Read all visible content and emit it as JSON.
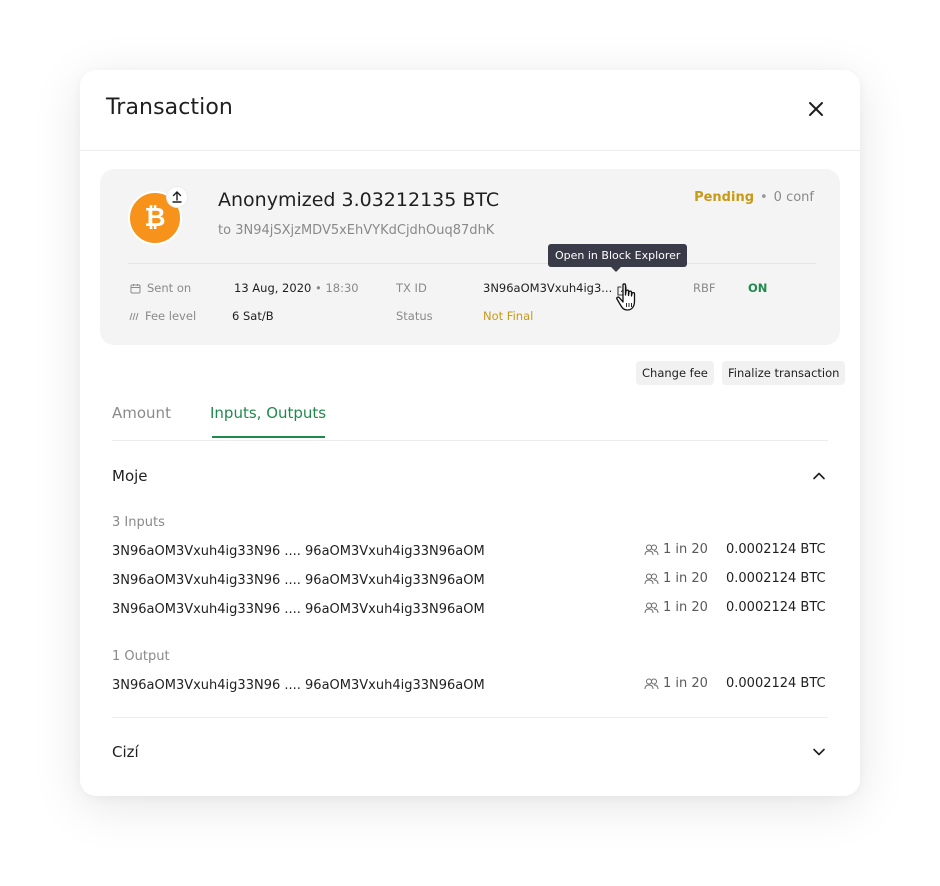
{
  "modal": {
    "title": "Transaction"
  },
  "transaction": {
    "title": "Anonymized 3.03212135 BTC",
    "to_prefix": "to",
    "to_address": "3N94jSXjzMDV5xEhVYKdCjdhOuq87dhK",
    "status": "Pending",
    "separator": "•",
    "confirmations": "0 conf",
    "coin_glyph": "₿",
    "coin_color": "#f7931a"
  },
  "details": {
    "sent_on_label": "Sent on",
    "sent_on_date": "13 Aug, 2020",
    "sent_on_sep": "•",
    "sent_on_time": "18:30",
    "fee_level_label": "Fee level",
    "fee_level_value": "6 Sat/B",
    "txid_label": "TX ID",
    "txid_value": "3N96aOM3Vxuh4ig3...",
    "status_label": "Status",
    "status_value": "Not Final",
    "rbf_label": "RBF",
    "rbf_value": "ON",
    "tooltip": "Open in Block Explorer"
  },
  "actions": {
    "change_fee": "Change fee",
    "finalize": "Finalize transaction"
  },
  "tabs": [
    {
      "label": "Amount",
      "active": false
    },
    {
      "label": "Inputs, Outputs",
      "active": true
    }
  ],
  "sections": {
    "mine": {
      "title": "Moje",
      "inputs_label": "3 Inputs",
      "inputs": [
        {
          "address": "3N96aOM3Vxuh4ig33N96 .... 96aOM3Vxuh4ig33N96aOM",
          "anonymity": "1 in 20",
          "amount": "0.0002124 BTC"
        },
        {
          "address": "3N96aOM3Vxuh4ig33N96 .... 96aOM3Vxuh4ig33N96aOM",
          "anonymity": "1 in 20",
          "amount": "0.0002124 BTC"
        },
        {
          "address": "3N96aOM3Vxuh4ig33N96 .... 96aOM3Vxuh4ig33N96aOM",
          "anonymity": "1 in 20",
          "amount": "0.0002124 BTC"
        }
      ],
      "outputs_label": "1 Output",
      "outputs": [
        {
          "address": "3N96aOM3Vxuh4ig33N96 .... 96aOM3Vxuh4ig33N96aOM",
          "anonymity": "1 in 20",
          "amount": "0.0002124 BTC"
        }
      ]
    },
    "foreign": {
      "title": "Cizí"
    }
  },
  "colors": {
    "accent": "#1f8a4c",
    "pending": "#c79a16",
    "tooltip_bg": "#3a3b48"
  }
}
